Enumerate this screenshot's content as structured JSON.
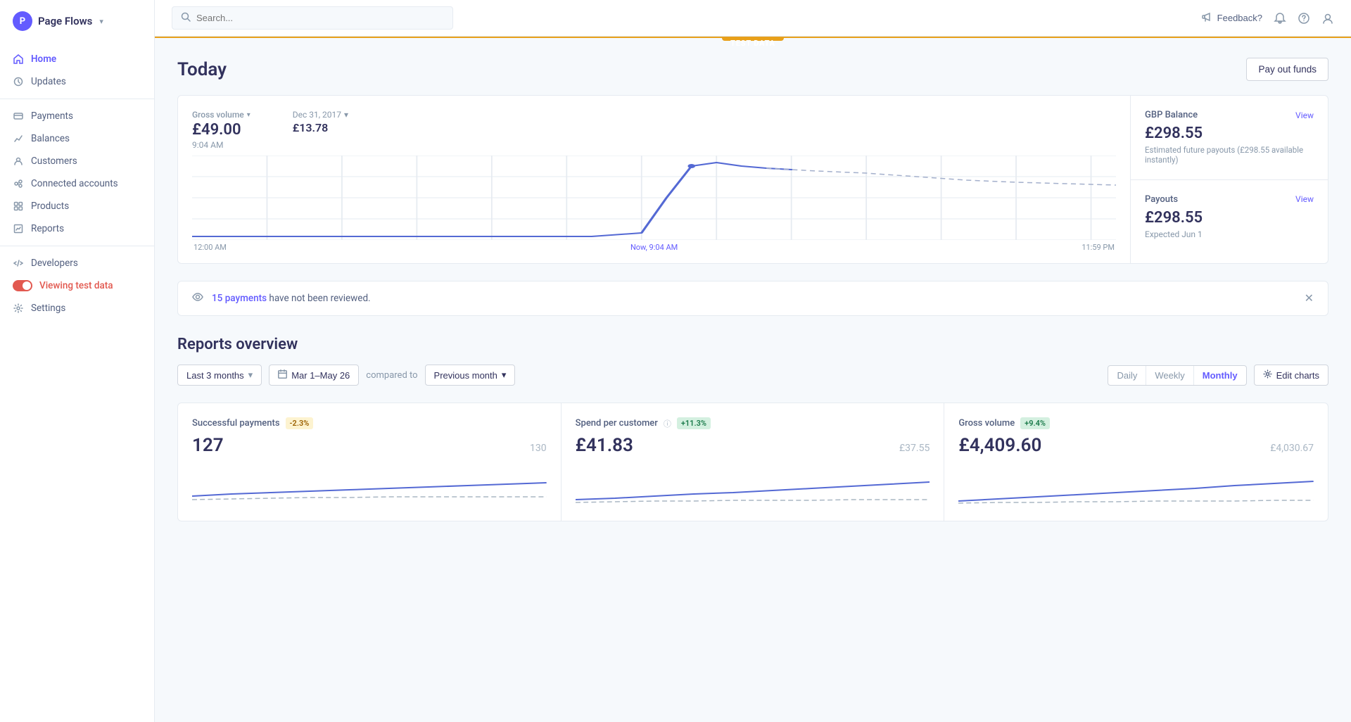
{
  "app": {
    "name": "Page Flows",
    "logo_letter": "P"
  },
  "sidebar": {
    "nav_items": [
      {
        "id": "home",
        "label": "Home",
        "icon": "home",
        "active": true
      },
      {
        "id": "updates",
        "label": "Updates",
        "icon": "updates",
        "active": false
      }
    ],
    "nav_items2": [
      {
        "id": "payments",
        "label": "Payments",
        "icon": "payments",
        "active": false
      },
      {
        "id": "balances",
        "label": "Balances",
        "icon": "balances",
        "active": false
      },
      {
        "id": "customers",
        "label": "Customers",
        "icon": "customers",
        "active": false
      },
      {
        "id": "connected-accounts",
        "label": "Connected accounts",
        "icon": "connected",
        "active": false
      },
      {
        "id": "products",
        "label": "Products",
        "icon": "products",
        "active": false
      },
      {
        "id": "reports",
        "label": "Reports",
        "icon": "reports",
        "active": false
      }
    ],
    "nav_items3": [
      {
        "id": "developers",
        "label": "Developers",
        "icon": "developers",
        "active": false
      }
    ],
    "test_data_label": "Viewing test data",
    "settings_label": "Settings"
  },
  "topbar": {
    "search_placeholder": "Search...",
    "feedback_label": "Feedback?"
  },
  "test_data_badge": "TEST DATA",
  "today_section": {
    "title": "Today",
    "pay_out_btn": "Pay out funds",
    "gross_volume_label": "Gross volume",
    "gross_volume_value": "£49.00",
    "gross_volume_time": "9:04 AM",
    "date_label": "Dec 31, 2017",
    "date_value": "£13.78",
    "chart_x_start": "12:00 AM",
    "chart_x_now": "Now, 9:04 AM",
    "chart_x_end": "11:59 PM",
    "balance_title": "GBP Balance",
    "balance_view": "View",
    "balance_value": "£298.55",
    "balance_sub": "Estimated future payouts (£298.55 available instantly)",
    "payouts_title": "Payouts",
    "payouts_view": "View",
    "payouts_value": "£298.55",
    "payouts_expected": "Expected Jun 1"
  },
  "notification": {
    "icon": "eye",
    "payments_link": "15 payments",
    "text": " have not been reviewed."
  },
  "reports": {
    "title": "Reports overview",
    "time_filter": "Last 3 months",
    "date_range": "Mar 1–May 26",
    "compared_to_label": "compared to",
    "compare_filter": "Previous month",
    "period_options": [
      "Daily",
      "Weekly",
      "Monthly"
    ],
    "active_period": "Monthly",
    "edit_charts": "Edit charts",
    "cards": [
      {
        "title": "Successful payments",
        "badge": "-2.3%",
        "badge_type": "negative",
        "main_value": "127",
        "compare_value": "130"
      },
      {
        "title": "Spend per customer",
        "has_info": true,
        "badge": "+11.3%",
        "badge_type": "positive",
        "main_value": "£41.83",
        "compare_value": "£37.55"
      },
      {
        "title": "Gross volume",
        "badge": "+9.4%",
        "badge_type": "positive",
        "main_value": "£4,409.60",
        "compare_value": "£4,030.67"
      }
    ]
  }
}
